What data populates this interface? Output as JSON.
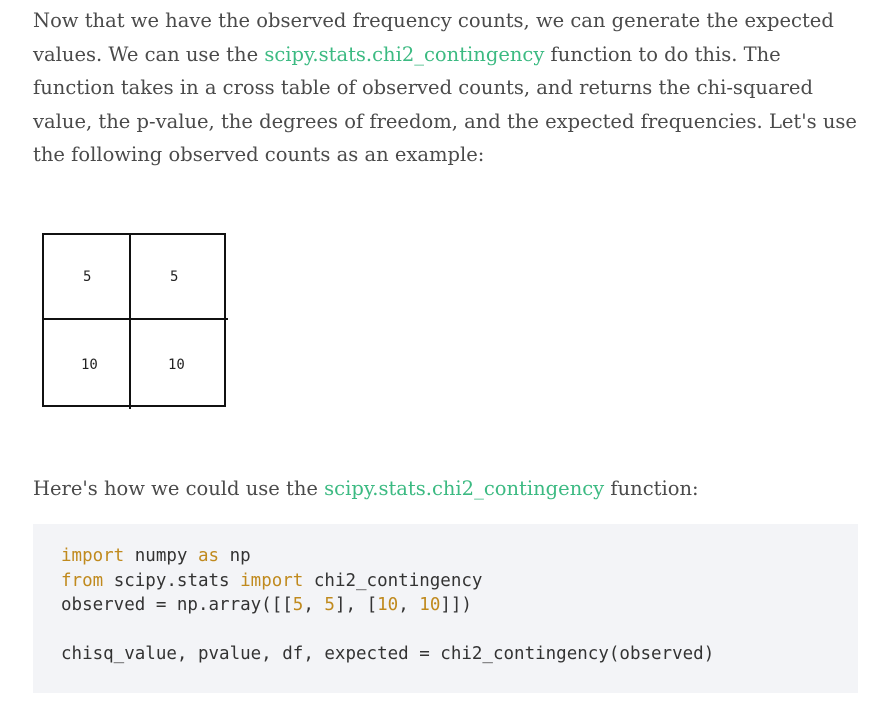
{
  "intro": {
    "text_a": "Now that we have the observed frequency counts, we can generate the expected values. We can use the ",
    "link": "scipy.stats.chi2_contingency",
    "text_b": " function to do this. The function takes in a cross table of observed counts, and returns the chi-squared value, the p-value, the degrees of freedom, and the expected frequencies. Let's use the following observed counts as an example:"
  },
  "table": {
    "cells": [
      "5",
      "5",
      "10",
      "10"
    ]
  },
  "usage": {
    "text_a": "Here's how we could use the ",
    "link": "scipy.stats.chi2_contingency",
    "text_b": " function:"
  },
  "code": {
    "l1_kw1": "import",
    "l1_mid": " numpy ",
    "l1_kw2": "as",
    "l1_end": " np",
    "l2_kw1": "from",
    "l2_mid": " scipy.stats ",
    "l2_kw2": "import",
    "l2_end": " chi2_contingency",
    "l3_a": "observed = np.array([[",
    "l3_n1": "5",
    "l3_b": ", ",
    "l3_n2": "5",
    "l3_c": "], [",
    "l3_n3": "10",
    "l3_d": ", ",
    "l3_n4": "10",
    "l3_e": "]])",
    "l4": "chisq_value, pvalue, df, expected = chi2_contingency(observed)"
  }
}
